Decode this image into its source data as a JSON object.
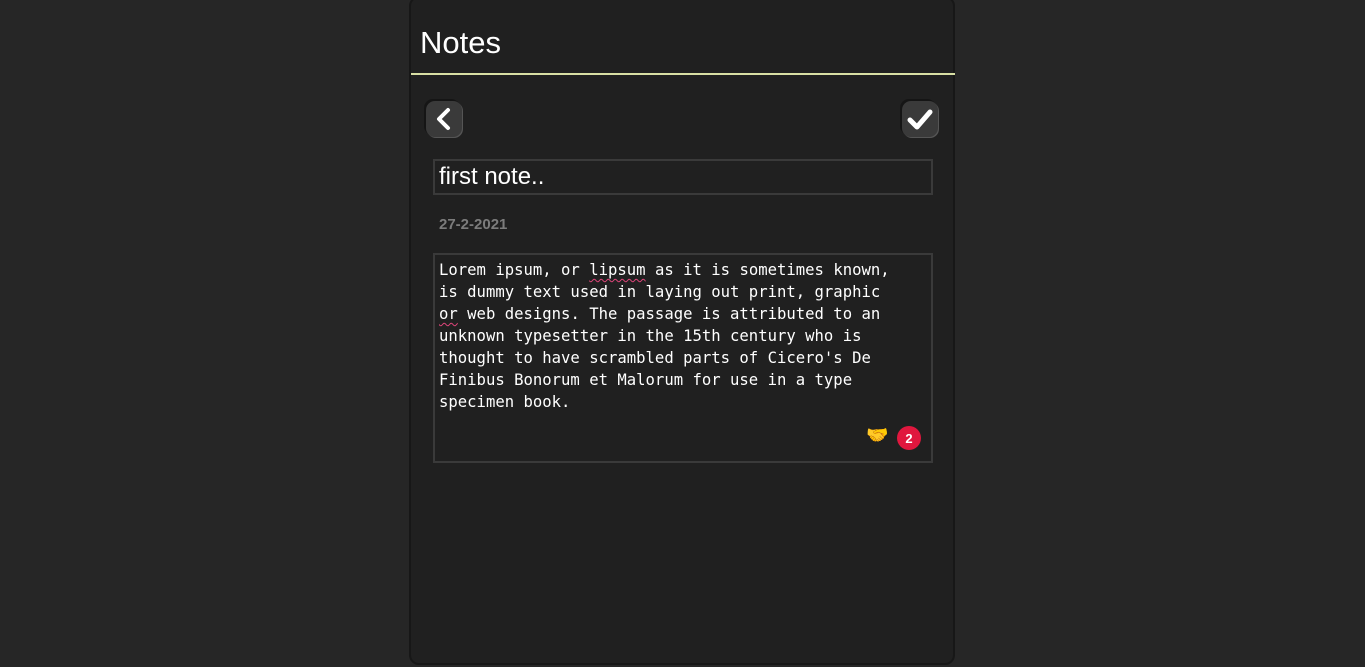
{
  "app": {
    "title": "Notes"
  },
  "toolbar": {
    "back_icon": "chevron-left-icon",
    "save_icon": "checkmark-icon"
  },
  "note": {
    "title_value": "first note..",
    "date": "27-2-2021",
    "body_part1": "Lorem ipsum, or ",
    "body_misspelled1": "lipsum",
    "body_part2": " as it is sometimes known,\nis dummy text used in laying out print, graphic\n",
    "body_misspelled2": "or",
    "body_part3": " web designs. The passage is attributed to an\nunknown typesetter in the 15th century who is\nthought to have scrambled parts of Cicero's De\nFinibus Bonorum et Malorum for use in a type\nspecimen book."
  },
  "extension": {
    "icon": "handshake-icon",
    "count": "2"
  },
  "colors": {
    "background": "#262626",
    "panel": "#202020",
    "header_underline": "#d8dfa4",
    "badge": "#e0173e"
  }
}
